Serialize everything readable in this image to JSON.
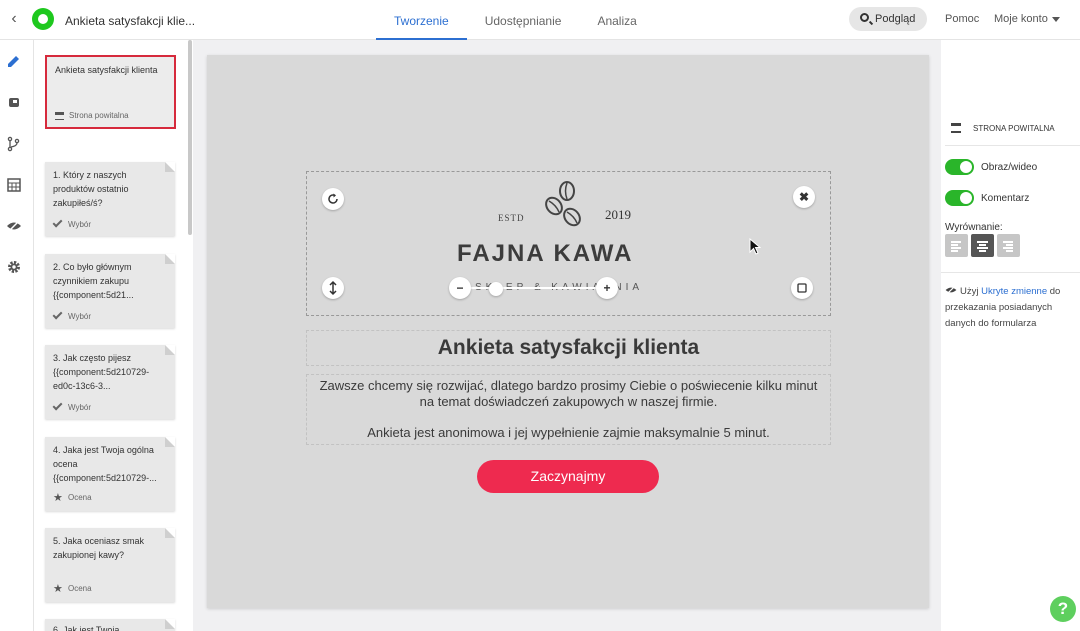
{
  "header": {
    "doc_title": "Ankieta satysfakcji klie...",
    "tabs": [
      {
        "label": "Tworzenie",
        "active": true
      },
      {
        "label": "Udostępnianie",
        "active": false
      },
      {
        "label": "Analiza",
        "active": false
      }
    ],
    "preview_label": "Podgląd",
    "help_label": "Pomoc",
    "account_label": "Moje konto"
  },
  "pages_panel": {
    "welcome": {
      "title": "Ankieta satysfakcji klienta",
      "type": "Strona powitalna"
    },
    "questions": [
      {
        "title": "1. Który z naszych produktów ostatnio zakupiłeś/ś?",
        "type": "Wybór",
        "icon": "check-icon"
      },
      {
        "title": "2. Co było głównym czynnikiem zakupu {{component:5d21...",
        "type": "Wybór",
        "icon": "check-icon"
      },
      {
        "title": "3. Jak często pijesz {{component:5d210729-ed0c-13c6-3...",
        "type": "Wybór",
        "icon": "check-icon"
      },
      {
        "title": "4. Jaka jest Twoja ogólna ocena {{component:5d210729-...",
        "type": "Ocena",
        "icon": "star-icon"
      },
      {
        "title": "5. Jaka oceniasz smak zakupionej kawy?",
        "type": "Ocena",
        "icon": "star-icon"
      },
      {
        "title": "6. Jak jest Twoja",
        "type": "",
        "icon": ""
      }
    ]
  },
  "canvas": {
    "logo": {
      "estd": "ESTD",
      "year": "2019",
      "brand": "FAJNA KAWA",
      "tagline": "SKLEP & KAWIARNIA"
    },
    "title": "Ankieta satysfakcji klienta",
    "description": "Zawsze chcemy się rozwijać, dlatego bardzo prosimy Ciebie o poświecenie kilku minut na temat doświadczeń zakupowych w naszej firmie.",
    "note": "Ankieta jest anonimowa i jej wypełnienie zajmie maksymalnie 5 minut.",
    "start_label": "Zaczynajmy",
    "zoom_fraction": 0.2
  },
  "right_panel": {
    "section_label": "STRONA POWITALNA",
    "toggles": [
      {
        "label": "Obraz/wideo",
        "on": true
      },
      {
        "label": "Komentarz",
        "on": true
      }
    ],
    "alignment_label": "Wyrównanie:",
    "alignment_selected": "center",
    "hint_prefix": "Użyj",
    "hint_link": "Ukryte zmienne",
    "hint_suffix": "do przekazania posiadanych danych do formularza"
  },
  "colors": {
    "accent": "#2c6fd1",
    "start_button": "#ee2a4f",
    "selected_border": "#d62a3c",
    "toggle_on": "#2ab52a",
    "logo": "#1ec81e"
  }
}
